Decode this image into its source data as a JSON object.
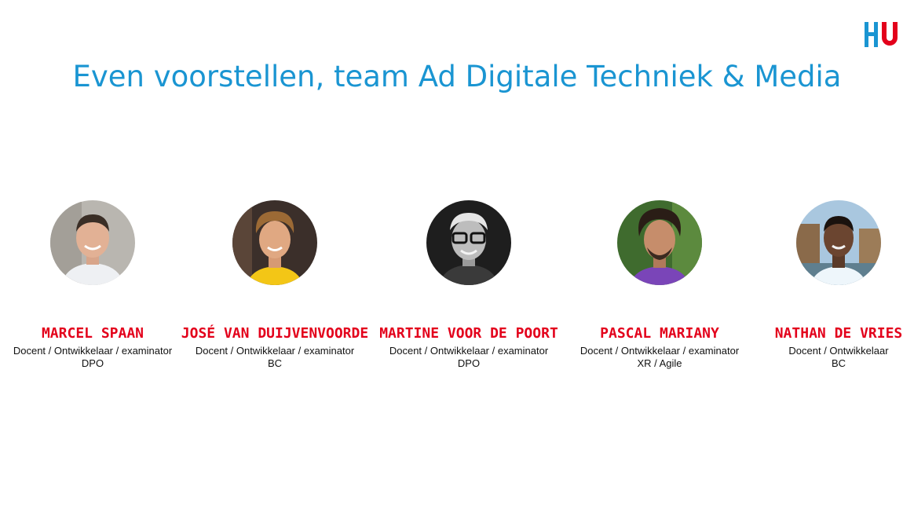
{
  "slide": {
    "title": "Even voorstellen, team Ad Digitale Techniek & Media",
    "logo": {
      "icon": "hu-logo",
      "colors": {
        "bars": "#1a95d2",
        "u": "#e3001b"
      }
    },
    "accent_colors": {
      "title": "#1a95d2",
      "names": "#e3001b"
    }
  },
  "team": [
    {
      "name": "Marcel Spaan",
      "role": "Docent / Ontwikkelaar / examinator",
      "tag": "DPO",
      "photo": "portrait-photo-icon"
    },
    {
      "name": "José van Duijvenvoorde",
      "role": "Docent / Ontwikkelaar / examinator",
      "tag": "BC",
      "photo": "portrait-photo-icon"
    },
    {
      "name": "Martine Voor de Poort",
      "role": "Docent / Ontwikkelaar / examinator",
      "tag": "DPO",
      "photo": "portrait-photo-icon"
    },
    {
      "name": "Pascal Mariany",
      "role": "Docent / Ontwikkelaar / examinator",
      "tag": "XR / Agile",
      "photo": "portrait-photo-icon"
    },
    {
      "name": "Nathan de Vries",
      "role": "Docent / Ontwikkelaar",
      "tag": "BC",
      "photo": "portrait-photo-icon"
    }
  ]
}
